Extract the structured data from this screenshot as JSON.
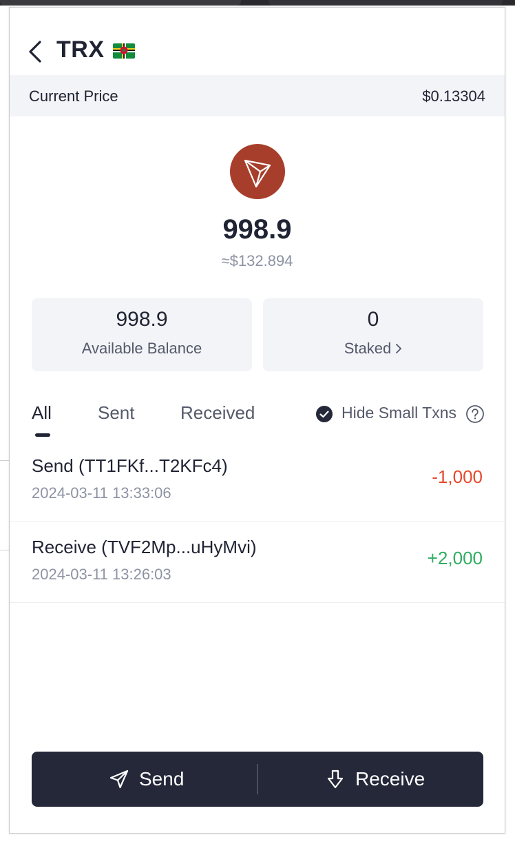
{
  "header": {
    "title": "TRX",
    "flag_icon": "dominica-flag-icon"
  },
  "price": {
    "label": "Current Price",
    "value": "$0.13304"
  },
  "token": {
    "logo_icon": "tron-logo-icon",
    "logo_color": "#a63e2b",
    "balance": "998.9",
    "fiat_value": "≈$132.894"
  },
  "cards": {
    "available": {
      "value": "998.9",
      "label": "Available Balance"
    },
    "staked": {
      "value": "0",
      "label": "Staked"
    }
  },
  "tabs": [
    {
      "label": "All",
      "active": true
    },
    {
      "label": "Sent",
      "active": false
    },
    {
      "label": "Received",
      "active": false
    }
  ],
  "filter": {
    "label": "Hide Small Txns",
    "checked": true
  },
  "transactions": [
    {
      "title": "Send (TT1FKf...T2KFc4)",
      "date": "2024-03-11 13:33:06",
      "amount": "-1,000",
      "color": "#e5492d"
    },
    {
      "title": "Receive (TVF2Mp...uHyMvi)",
      "date": "2024-03-11 13:26:03",
      "amount": "+2,000",
      "color": "#2eae60"
    }
  ],
  "actions": {
    "send_label": "Send",
    "receive_label": "Receive"
  },
  "colors": {
    "text_primary": "#1f2333",
    "text_secondary": "#8d93a3",
    "action_bar": "#242839"
  }
}
